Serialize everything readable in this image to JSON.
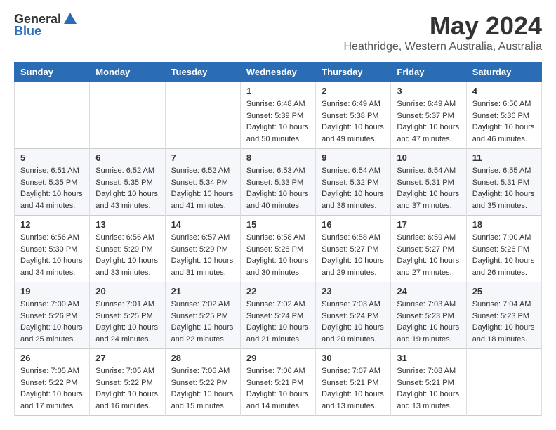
{
  "logo": {
    "general": "General",
    "blue": "Blue"
  },
  "header": {
    "month": "May 2024",
    "location": "Heathridge, Western Australia, Australia"
  },
  "days_of_week": [
    "Sunday",
    "Monday",
    "Tuesday",
    "Wednesday",
    "Thursday",
    "Friday",
    "Saturday"
  ],
  "weeks": [
    [
      {
        "day": "",
        "info": ""
      },
      {
        "day": "",
        "info": ""
      },
      {
        "day": "",
        "info": ""
      },
      {
        "day": "1",
        "info": "Sunrise: 6:48 AM\nSunset: 5:39 PM\nDaylight: 10 hours and 50 minutes."
      },
      {
        "day": "2",
        "info": "Sunrise: 6:49 AM\nSunset: 5:38 PM\nDaylight: 10 hours and 49 minutes."
      },
      {
        "day": "3",
        "info": "Sunrise: 6:49 AM\nSunset: 5:37 PM\nDaylight: 10 hours and 47 minutes."
      },
      {
        "day": "4",
        "info": "Sunrise: 6:50 AM\nSunset: 5:36 PM\nDaylight: 10 hours and 46 minutes."
      }
    ],
    [
      {
        "day": "5",
        "info": "Sunrise: 6:51 AM\nSunset: 5:35 PM\nDaylight: 10 hours and 44 minutes."
      },
      {
        "day": "6",
        "info": "Sunrise: 6:52 AM\nSunset: 5:35 PM\nDaylight: 10 hours and 43 minutes."
      },
      {
        "day": "7",
        "info": "Sunrise: 6:52 AM\nSunset: 5:34 PM\nDaylight: 10 hours and 41 minutes."
      },
      {
        "day": "8",
        "info": "Sunrise: 6:53 AM\nSunset: 5:33 PM\nDaylight: 10 hours and 40 minutes."
      },
      {
        "day": "9",
        "info": "Sunrise: 6:54 AM\nSunset: 5:32 PM\nDaylight: 10 hours and 38 minutes."
      },
      {
        "day": "10",
        "info": "Sunrise: 6:54 AM\nSunset: 5:31 PM\nDaylight: 10 hours and 37 minutes."
      },
      {
        "day": "11",
        "info": "Sunrise: 6:55 AM\nSunset: 5:31 PM\nDaylight: 10 hours and 35 minutes."
      }
    ],
    [
      {
        "day": "12",
        "info": "Sunrise: 6:56 AM\nSunset: 5:30 PM\nDaylight: 10 hours and 34 minutes."
      },
      {
        "day": "13",
        "info": "Sunrise: 6:56 AM\nSunset: 5:29 PM\nDaylight: 10 hours and 33 minutes."
      },
      {
        "day": "14",
        "info": "Sunrise: 6:57 AM\nSunset: 5:29 PM\nDaylight: 10 hours and 31 minutes."
      },
      {
        "day": "15",
        "info": "Sunrise: 6:58 AM\nSunset: 5:28 PM\nDaylight: 10 hours and 30 minutes."
      },
      {
        "day": "16",
        "info": "Sunrise: 6:58 AM\nSunset: 5:27 PM\nDaylight: 10 hours and 29 minutes."
      },
      {
        "day": "17",
        "info": "Sunrise: 6:59 AM\nSunset: 5:27 PM\nDaylight: 10 hours and 27 minutes."
      },
      {
        "day": "18",
        "info": "Sunrise: 7:00 AM\nSunset: 5:26 PM\nDaylight: 10 hours and 26 minutes."
      }
    ],
    [
      {
        "day": "19",
        "info": "Sunrise: 7:00 AM\nSunset: 5:26 PM\nDaylight: 10 hours and 25 minutes."
      },
      {
        "day": "20",
        "info": "Sunrise: 7:01 AM\nSunset: 5:25 PM\nDaylight: 10 hours and 24 minutes."
      },
      {
        "day": "21",
        "info": "Sunrise: 7:02 AM\nSunset: 5:25 PM\nDaylight: 10 hours and 22 minutes."
      },
      {
        "day": "22",
        "info": "Sunrise: 7:02 AM\nSunset: 5:24 PM\nDaylight: 10 hours and 21 minutes."
      },
      {
        "day": "23",
        "info": "Sunrise: 7:03 AM\nSunset: 5:24 PM\nDaylight: 10 hours and 20 minutes."
      },
      {
        "day": "24",
        "info": "Sunrise: 7:03 AM\nSunset: 5:23 PM\nDaylight: 10 hours and 19 minutes."
      },
      {
        "day": "25",
        "info": "Sunrise: 7:04 AM\nSunset: 5:23 PM\nDaylight: 10 hours and 18 minutes."
      }
    ],
    [
      {
        "day": "26",
        "info": "Sunrise: 7:05 AM\nSunset: 5:22 PM\nDaylight: 10 hours and 17 minutes."
      },
      {
        "day": "27",
        "info": "Sunrise: 7:05 AM\nSunset: 5:22 PM\nDaylight: 10 hours and 16 minutes."
      },
      {
        "day": "28",
        "info": "Sunrise: 7:06 AM\nSunset: 5:22 PM\nDaylight: 10 hours and 15 minutes."
      },
      {
        "day": "29",
        "info": "Sunrise: 7:06 AM\nSunset: 5:21 PM\nDaylight: 10 hours and 14 minutes."
      },
      {
        "day": "30",
        "info": "Sunrise: 7:07 AM\nSunset: 5:21 PM\nDaylight: 10 hours and 13 minutes."
      },
      {
        "day": "31",
        "info": "Sunrise: 7:08 AM\nSunset: 5:21 PM\nDaylight: 10 hours and 13 minutes."
      },
      {
        "day": "",
        "info": ""
      }
    ]
  ]
}
